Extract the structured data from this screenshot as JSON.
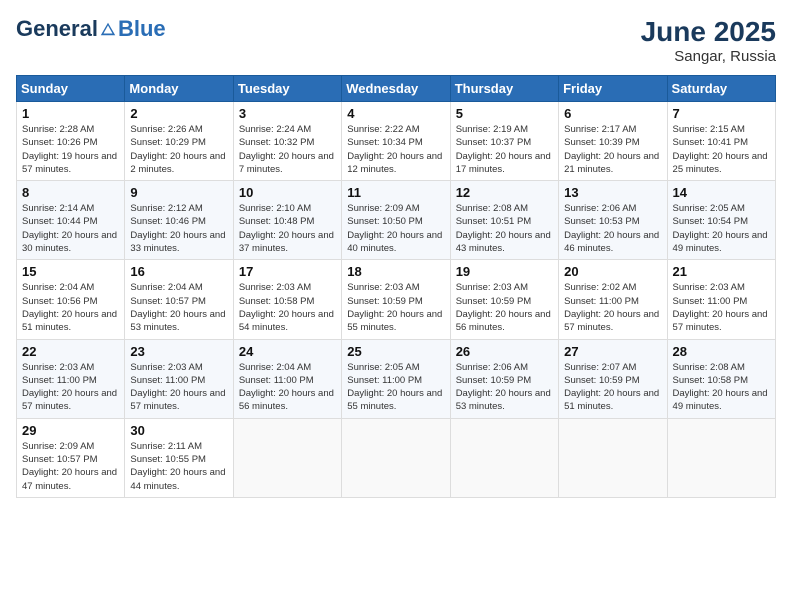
{
  "header": {
    "logo_general": "General",
    "logo_blue": "Blue",
    "month": "June 2025",
    "location": "Sangar, Russia"
  },
  "weekdays": [
    "Sunday",
    "Monday",
    "Tuesday",
    "Wednesday",
    "Thursday",
    "Friday",
    "Saturday"
  ],
  "weeks": [
    [
      {
        "day": "1",
        "sunrise": "2:28 AM",
        "sunset": "10:26 PM",
        "daylight": "19 hours and 57 minutes."
      },
      {
        "day": "2",
        "sunrise": "2:26 AM",
        "sunset": "10:29 PM",
        "daylight": "20 hours and 2 minutes."
      },
      {
        "day": "3",
        "sunrise": "2:24 AM",
        "sunset": "10:32 PM",
        "daylight": "20 hours and 7 minutes."
      },
      {
        "day": "4",
        "sunrise": "2:22 AM",
        "sunset": "10:34 PM",
        "daylight": "20 hours and 12 minutes."
      },
      {
        "day": "5",
        "sunrise": "2:19 AM",
        "sunset": "10:37 PM",
        "daylight": "20 hours and 17 minutes."
      },
      {
        "day": "6",
        "sunrise": "2:17 AM",
        "sunset": "10:39 PM",
        "daylight": "20 hours and 21 minutes."
      },
      {
        "day": "7",
        "sunrise": "2:15 AM",
        "sunset": "10:41 PM",
        "daylight": "20 hours and 25 minutes."
      }
    ],
    [
      {
        "day": "8",
        "sunrise": "2:14 AM",
        "sunset": "10:44 PM",
        "daylight": "20 hours and 30 minutes."
      },
      {
        "day": "9",
        "sunrise": "2:12 AM",
        "sunset": "10:46 PM",
        "daylight": "20 hours and 33 minutes."
      },
      {
        "day": "10",
        "sunrise": "2:10 AM",
        "sunset": "10:48 PM",
        "daylight": "20 hours and 37 minutes."
      },
      {
        "day": "11",
        "sunrise": "2:09 AM",
        "sunset": "10:50 PM",
        "daylight": "20 hours and 40 minutes."
      },
      {
        "day": "12",
        "sunrise": "2:08 AM",
        "sunset": "10:51 PM",
        "daylight": "20 hours and 43 minutes."
      },
      {
        "day": "13",
        "sunrise": "2:06 AM",
        "sunset": "10:53 PM",
        "daylight": "20 hours and 46 minutes."
      },
      {
        "day": "14",
        "sunrise": "2:05 AM",
        "sunset": "10:54 PM",
        "daylight": "20 hours and 49 minutes."
      }
    ],
    [
      {
        "day": "15",
        "sunrise": "2:04 AM",
        "sunset": "10:56 PM",
        "daylight": "20 hours and 51 minutes."
      },
      {
        "day": "16",
        "sunrise": "2:04 AM",
        "sunset": "10:57 PM",
        "daylight": "20 hours and 53 minutes."
      },
      {
        "day": "17",
        "sunrise": "2:03 AM",
        "sunset": "10:58 PM",
        "daylight": "20 hours and 54 minutes."
      },
      {
        "day": "18",
        "sunrise": "2:03 AM",
        "sunset": "10:59 PM",
        "daylight": "20 hours and 55 minutes."
      },
      {
        "day": "19",
        "sunrise": "2:03 AM",
        "sunset": "10:59 PM",
        "daylight": "20 hours and 56 minutes."
      },
      {
        "day": "20",
        "sunrise": "2:02 AM",
        "sunset": "11:00 PM",
        "daylight": "20 hours and 57 minutes."
      },
      {
        "day": "21",
        "sunrise": "2:03 AM",
        "sunset": "11:00 PM",
        "daylight": "20 hours and 57 minutes."
      }
    ],
    [
      {
        "day": "22",
        "sunrise": "2:03 AM",
        "sunset": "11:00 PM",
        "daylight": "20 hours and 57 minutes."
      },
      {
        "day": "23",
        "sunrise": "2:03 AM",
        "sunset": "11:00 PM",
        "daylight": "20 hours and 57 minutes."
      },
      {
        "day": "24",
        "sunrise": "2:04 AM",
        "sunset": "11:00 PM",
        "daylight": "20 hours and 56 minutes."
      },
      {
        "day": "25",
        "sunrise": "2:05 AM",
        "sunset": "11:00 PM",
        "daylight": "20 hours and 55 minutes."
      },
      {
        "day": "26",
        "sunrise": "2:06 AM",
        "sunset": "10:59 PM",
        "daylight": "20 hours and 53 minutes."
      },
      {
        "day": "27",
        "sunrise": "2:07 AM",
        "sunset": "10:59 PM",
        "daylight": "20 hours and 51 minutes."
      },
      {
        "day": "28",
        "sunrise": "2:08 AM",
        "sunset": "10:58 PM",
        "daylight": "20 hours and 49 minutes."
      }
    ],
    [
      {
        "day": "29",
        "sunrise": "2:09 AM",
        "sunset": "10:57 PM",
        "daylight": "20 hours and 47 minutes."
      },
      {
        "day": "30",
        "sunrise": "2:11 AM",
        "sunset": "10:55 PM",
        "daylight": "20 hours and 44 minutes."
      },
      null,
      null,
      null,
      null,
      null
    ]
  ]
}
